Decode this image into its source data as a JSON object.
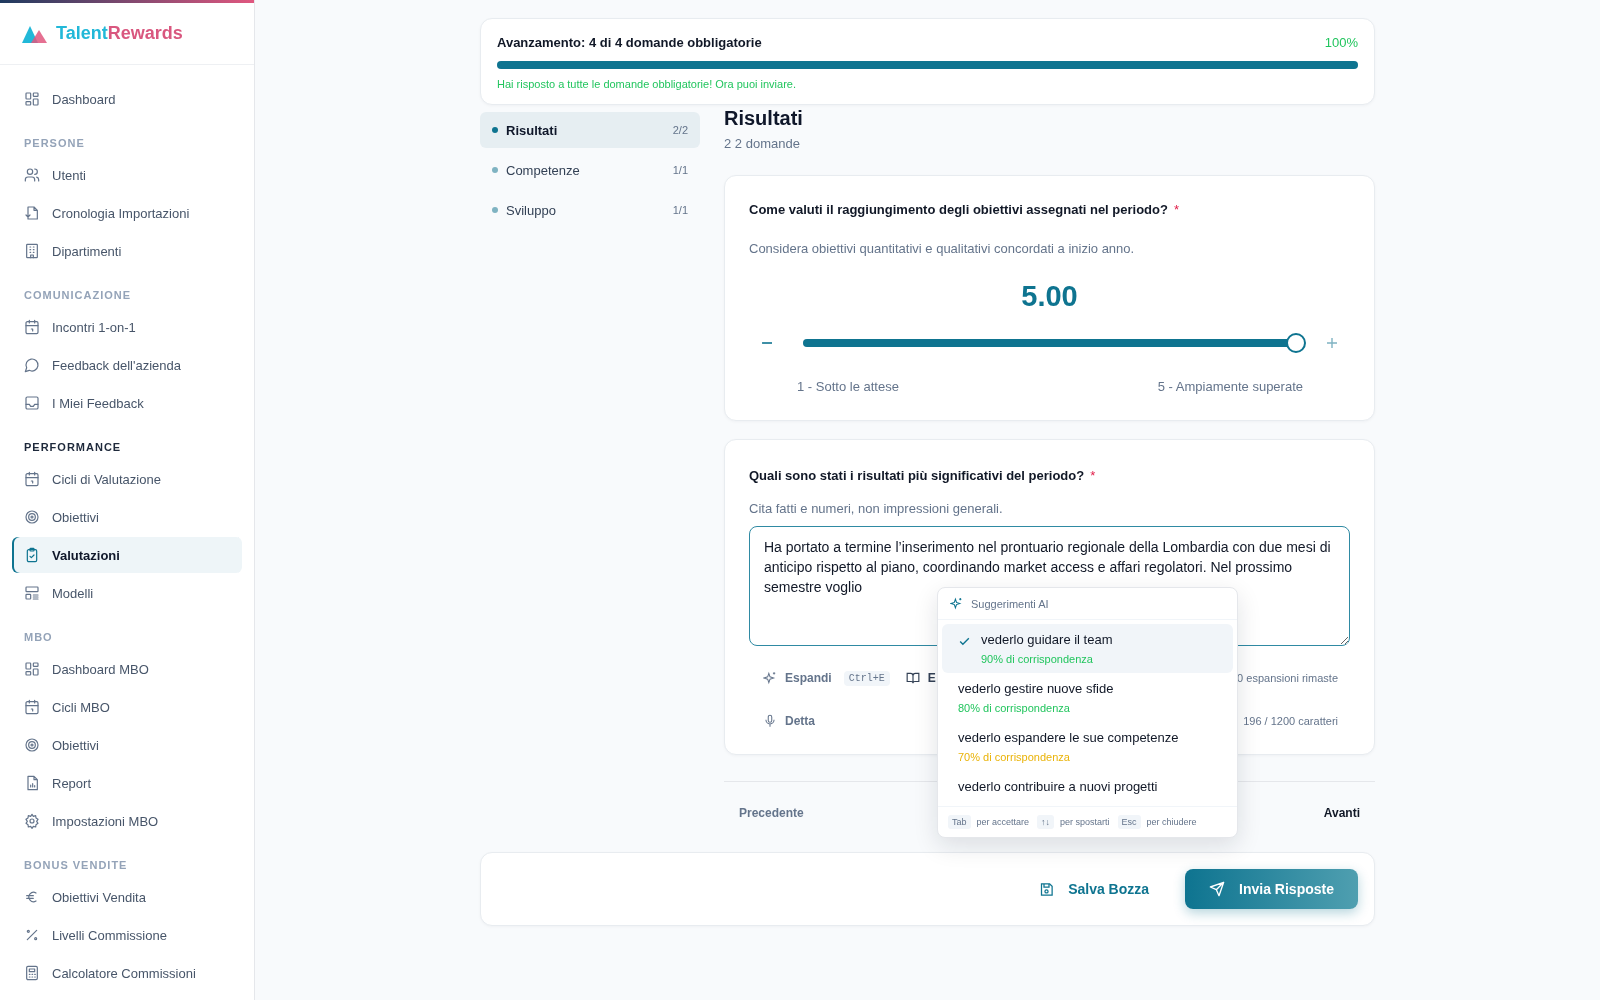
{
  "sidebar": {
    "brand": [
      "Talent",
      "Rewards"
    ],
    "sections": [
      {
        "items": [
          {
            "label": "Dashboard",
            "selected": false
          }
        ]
      },
      {
        "heading": "PERSONE",
        "current": false,
        "items": [
          {
            "label": "Utenti",
            "selected": false
          },
          {
            "label": "Cronologia Importazioni",
            "selected": false
          },
          {
            "label": "Dipartimenti",
            "selected": false
          }
        ]
      },
      {
        "heading": "COMUNICAZIONE",
        "current": false,
        "items": [
          {
            "label": "Incontri 1-on-1",
            "selected": false
          },
          {
            "label": "Feedback dell'azienda",
            "selected": false
          },
          {
            "label": "I Miei Feedback",
            "selected": false
          }
        ]
      },
      {
        "heading": "PERFORMANCE",
        "current": true,
        "items": [
          {
            "label": "Cicli di Valutazione",
            "selected": false
          },
          {
            "label": "Obiettivi",
            "selected": false
          },
          {
            "label": "Valutazioni",
            "selected": true
          },
          {
            "label": "Modelli",
            "selected": false
          }
        ]
      },
      {
        "heading": "MBO",
        "current": false,
        "items": [
          {
            "label": "Dashboard MBO",
            "selected": false
          },
          {
            "label": "Cicli MBO",
            "selected": false
          },
          {
            "label": "Obiettivi",
            "selected": false
          },
          {
            "label": "Report",
            "selected": false
          },
          {
            "label": "Impostazioni MBO",
            "selected": false
          }
        ]
      },
      {
        "heading": "BONUS VENDITE",
        "current": false,
        "items": [
          {
            "label": "Obiettivi Vendita",
            "selected": false
          },
          {
            "label": "Livelli Commissione",
            "selected": false
          },
          {
            "label": "Calcolatore Commissioni",
            "selected": false
          }
        ]
      }
    ]
  },
  "progress": {
    "label": "Avanzamento: 4 di 4 domande obbligatorie",
    "percent": "100%",
    "level": 1,
    "message": "Hai risposto a tutte le domande obbligatorie! Ora puoi inviare."
  },
  "section_nav": [
    {
      "label": "Risultati",
      "count": "2/2",
      "selected": true
    },
    {
      "label": "Competenze",
      "count": "1/1",
      "selected": false
    },
    {
      "label": "Sviluppo",
      "count": "1/1",
      "selected": false
    }
  ],
  "section": {
    "title": "Risultati",
    "subtitle": "2 2 domande"
  },
  "questions": [
    {
      "kind": "scale",
      "question": "Come valuti il raggiungimento degli obiettivi assegnati nel periodo?",
      "required_mark": "*",
      "hint": "Considera obiettivi quantitativi e qualitativi concordati a inizio anno.",
      "value": "5.00",
      "level": 1,
      "min_label": "1 - Sotto le attese",
      "max_label": "5 - Ampiamente superate"
    },
    {
      "kind": "text",
      "question": "Quali sono stati i risultati più significativi del periodo?",
      "required_mark": "*",
      "hint": "Cita fatti e numeri, non impressioni generali.",
      "value": "Ha portato a termine l’inserimento nel prontuario regionale della Lombardia con due mesi di anticipo rispetto al piano, coordinando market access e affari regolatori. Nel prossimo semestre voglio",
      "expand": {
        "label": "Espandi",
        "shortcut": "Ctrl+E"
      },
      "second_tool": "E",
      "remaining": "0 espansioni rimaste",
      "dictate": "Detta",
      "char_count": "196 / 1200 caratteri"
    }
  ],
  "popup": {
    "title": "Suggerimenti AI",
    "suggestions": [
      {
        "text": "vederlo guidare il team",
        "match": "90% di corrispondenza",
        "color": "#22c55e",
        "selected": true
      },
      {
        "text": "vederlo gestire nuove sfide",
        "match": "80% di corrispondenza",
        "color": "#22c55e",
        "selected": false
      },
      {
        "text": "vederlo espandere le sue competenze",
        "match": "70% di corrispondenza",
        "color": "#eab308",
        "selected": false
      },
      {
        "text": "vederlo contribuire a nuovi progetti",
        "selected": false
      }
    ],
    "hints": [
      {
        "key": "Tab",
        "text": "per accettare"
      },
      {
        "key": "↑↓",
        "text": "per spostarti"
      },
      {
        "key": "Esc",
        "text": "per chiudere"
      }
    ]
  },
  "nav": {
    "previous": "Precedente",
    "next": "Avanti"
  },
  "actions": {
    "save": "Salva Bozza",
    "submit": "Invia Risposte"
  }
}
